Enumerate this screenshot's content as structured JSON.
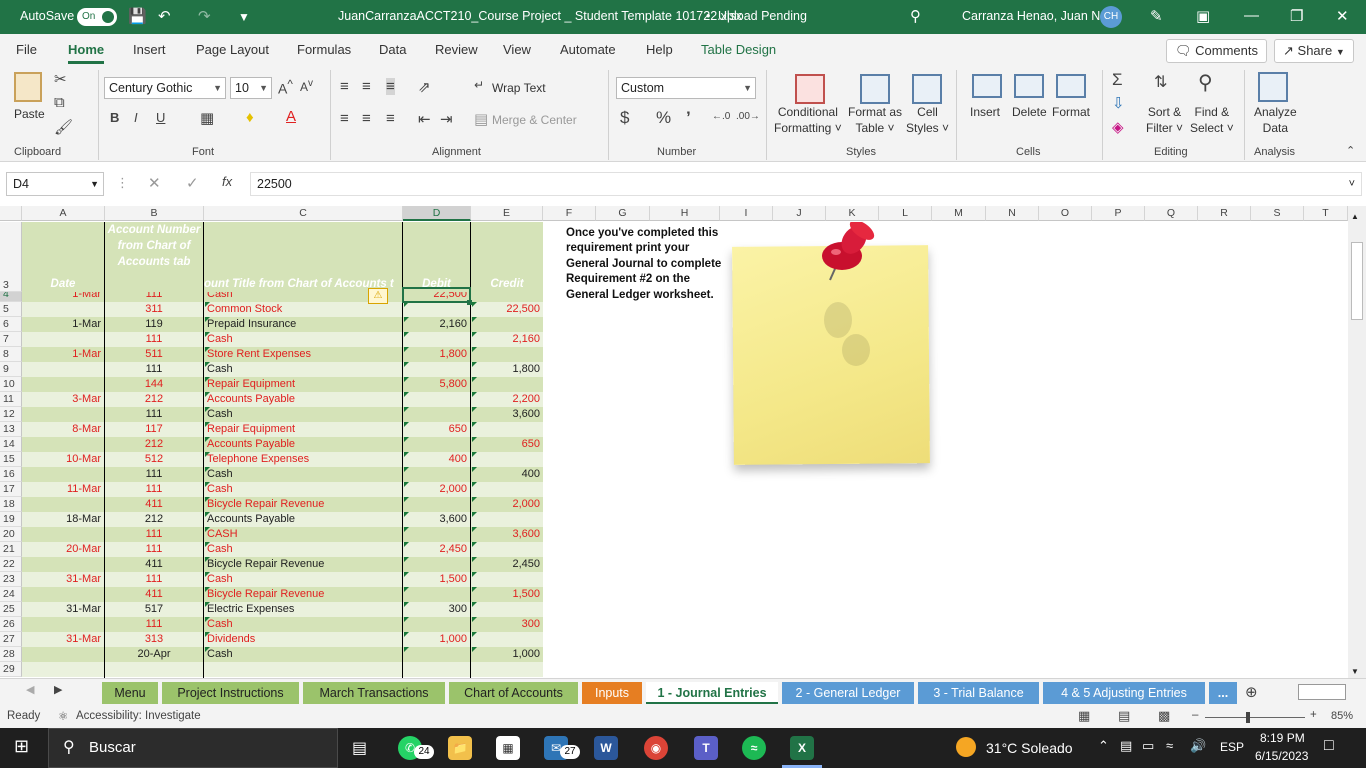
{
  "titlebar": {
    "autosave_label": "AutoSave",
    "autosave_state": "On",
    "doc_title": "JuanCarranzaACCT210_Course Project _ Student Template 101722.xlsx",
    "doc_status": "Upload Pending",
    "user_name": "Carranza Henao, Juan N.",
    "user_initials": "CH"
  },
  "ribbon_tabs": [
    "File",
    "Home",
    "Insert",
    "Page Layout",
    "Formulas",
    "Data",
    "Review",
    "View",
    "Automate",
    "Help",
    "Table Design"
  ],
  "ribbon_buttons": {
    "comments": "Comments",
    "share": "Share"
  },
  "ribbon": {
    "paste": "Paste",
    "font_name": "Century Gothic",
    "font_size": "10",
    "wrap_text": "Wrap Text",
    "merge_center": "Merge & Center",
    "number_format": "Custom",
    "cond_format_1": "Conditional",
    "cond_format_2": "Formatting",
    "format_table_1": "Format as",
    "format_table_2": "Table",
    "cell_styles_1": "Cell",
    "cell_styles_2": "Styles",
    "insert": "Insert",
    "delete": "Delete",
    "format": "Format",
    "sort_filter_1": "Sort &",
    "sort_filter_2": "Filter",
    "find_select_1": "Find &",
    "find_select_2": "Select",
    "analyze_1": "Analyze",
    "analyze_2": "Data",
    "groups": [
      "Clipboard",
      "Font",
      "Alignment",
      "Number",
      "Styles",
      "Cells",
      "Editing",
      "Analysis"
    ]
  },
  "formula_bar": {
    "name_box": "D4",
    "fx": "fx",
    "formula": "22500"
  },
  "columns": [
    "A",
    "B",
    "C",
    "D",
    "E",
    "F",
    "G",
    "H",
    "I",
    "J",
    "K",
    "L",
    "M",
    "N",
    "O",
    "P",
    "Q",
    "R",
    "S",
    "T"
  ],
  "table_header": {
    "row": "3",
    "date": "Date",
    "account_number": "Account Number from Chart of Accounts tab",
    "account_title": "ount Title from Chart of Accounts t",
    "debit": "Debit",
    "credit": "Credit"
  },
  "rows": [
    {
      "n": "4",
      "date": "1-Mar",
      "acct": "111",
      "title": "Cash",
      "debit": "22,500",
      "credit": "",
      "red": true
    },
    {
      "n": "5",
      "date": "",
      "acct": "311",
      "title": "Common Stock",
      "debit": "",
      "credit": "22,500",
      "red": true
    },
    {
      "n": "6",
      "date": "1-Mar",
      "acct": "119",
      "title": "Prepaid Insurance",
      "debit": "2,160",
      "credit": "",
      "red": false
    },
    {
      "n": "7",
      "date": "",
      "acct": "111",
      "title": "Cash",
      "debit": "",
      "credit": "2,160",
      "red": true
    },
    {
      "n": "8",
      "date": "1-Mar",
      "acct": "511",
      "title": "Store Rent Expenses",
      "debit": "1,800",
      "credit": "",
      "red": true
    },
    {
      "n": "9",
      "date": "",
      "acct": "111",
      "title": "Cash",
      "debit": "",
      "credit": "1,800",
      "red": false
    },
    {
      "n": "10",
      "date": "",
      "acct": "144",
      "title": "Repair Equipment",
      "debit": "5,800",
      "credit": "",
      "red": true
    },
    {
      "n": "11",
      "date": "3-Mar",
      "acct": "212",
      "title": "Accounts Payable",
      "debit": "",
      "credit": "2,200",
      "red": true
    },
    {
      "n": "12",
      "date": "",
      "acct": "111",
      "title": "Cash",
      "debit": "",
      "credit": "3,600",
      "red": false
    },
    {
      "n": "13",
      "date": "8-Mar",
      "acct": "117",
      "title": "Repair Equipment",
      "debit": "650",
      "credit": "",
      "red": true
    },
    {
      "n": "14",
      "date": "",
      "acct": "212",
      "title": "Accounts Payable",
      "debit": "",
      "credit": "650",
      "red": true
    },
    {
      "n": "15",
      "date": "10-Mar",
      "acct": "512",
      "title": "Telephone Expenses",
      "debit": "400",
      "credit": "",
      "red": true
    },
    {
      "n": "16",
      "date": "",
      "acct": "111",
      "title": "Cash",
      "debit": "",
      "credit": "400",
      "red": false
    },
    {
      "n": "17",
      "date": "11-Mar",
      "acct": "111",
      "title": "Cash",
      "debit": "2,000",
      "credit": "",
      "red": true
    },
    {
      "n": "18",
      "date": "",
      "acct": "411",
      "title": "Bicycle Repair Revenue",
      "debit": "",
      "credit": "2,000",
      "red": true
    },
    {
      "n": "19",
      "date": "18-Mar",
      "acct": "212",
      "title": "Accounts Payable",
      "debit": "3,600",
      "credit": "",
      "red": false
    },
    {
      "n": "20",
      "date": "",
      "acct": "111",
      "title": "CASH",
      "debit": "",
      "credit": "3,600",
      "red": true
    },
    {
      "n": "21",
      "date": "20-Mar",
      "acct": "111",
      "title": "Cash",
      "debit": "2,450",
      "credit": "",
      "red": true
    },
    {
      "n": "22",
      "date": "",
      "acct": "411",
      "title": "Bicycle Repair Revenue",
      "debit": "",
      "credit": "2,450",
      "red": false
    },
    {
      "n": "23",
      "date": "31-Mar",
      "acct": "111",
      "title": "Cash",
      "debit": "1,500",
      "credit": "",
      "red": true
    },
    {
      "n": "24",
      "date": "",
      "acct": "411",
      "title": "Bicycle Repair Revenue",
      "debit": "",
      "credit": "1,500",
      "red": true
    },
    {
      "n": "25",
      "date": "31-Mar",
      "acct": "517",
      "title": "Electric Expenses",
      "debit": "300",
      "credit": "",
      "red": false
    },
    {
      "n": "26",
      "date": "",
      "acct": "111",
      "title": "Cash",
      "debit": "",
      "credit": "300",
      "red": true
    },
    {
      "n": "27",
      "date": "31-Mar",
      "acct": "313",
      "title": "Dividends",
      "debit": "1,000",
      "credit": "",
      "red": true
    },
    {
      "n": "28",
      "date": "",
      "acct": "20-Apr",
      "title": "Cash",
      "debit": "",
      "credit": "1,000",
      "red": false
    },
    {
      "n": "29",
      "date": "",
      "acct": "",
      "title": "",
      "debit": "",
      "credit": "",
      "red": false
    }
  ],
  "note_text": "Once you've completed this requirement print your General Journal to complete Requirement #2 on the General Ledger worksheet.",
  "sheet_tabs": [
    "Menu",
    "Project Instructions",
    "March Transactions",
    "Chart of Accounts",
    "Inputs",
    "1 - Journal Entries",
    "2 - General Ledger",
    "3 - Trial Balance",
    "4 & 5 Adjusting Entries",
    "..."
  ],
  "status": {
    "ready": "Ready",
    "accessibility": "Accessibility: Investigate",
    "zoom": "85%"
  },
  "taskbar": {
    "search": "Buscar",
    "whatsapp_badge": "24",
    "mail_badge": "27",
    "weather": "31°C  Soleado",
    "lang": "ESP",
    "time": "8:19 PM",
    "date": "6/15/2023"
  },
  "colors": {
    "excel_green": "#217346",
    "header_fill": "#d5e3b8",
    "red_text": "#e02020",
    "note_yellow": "#f7ec95"
  }
}
